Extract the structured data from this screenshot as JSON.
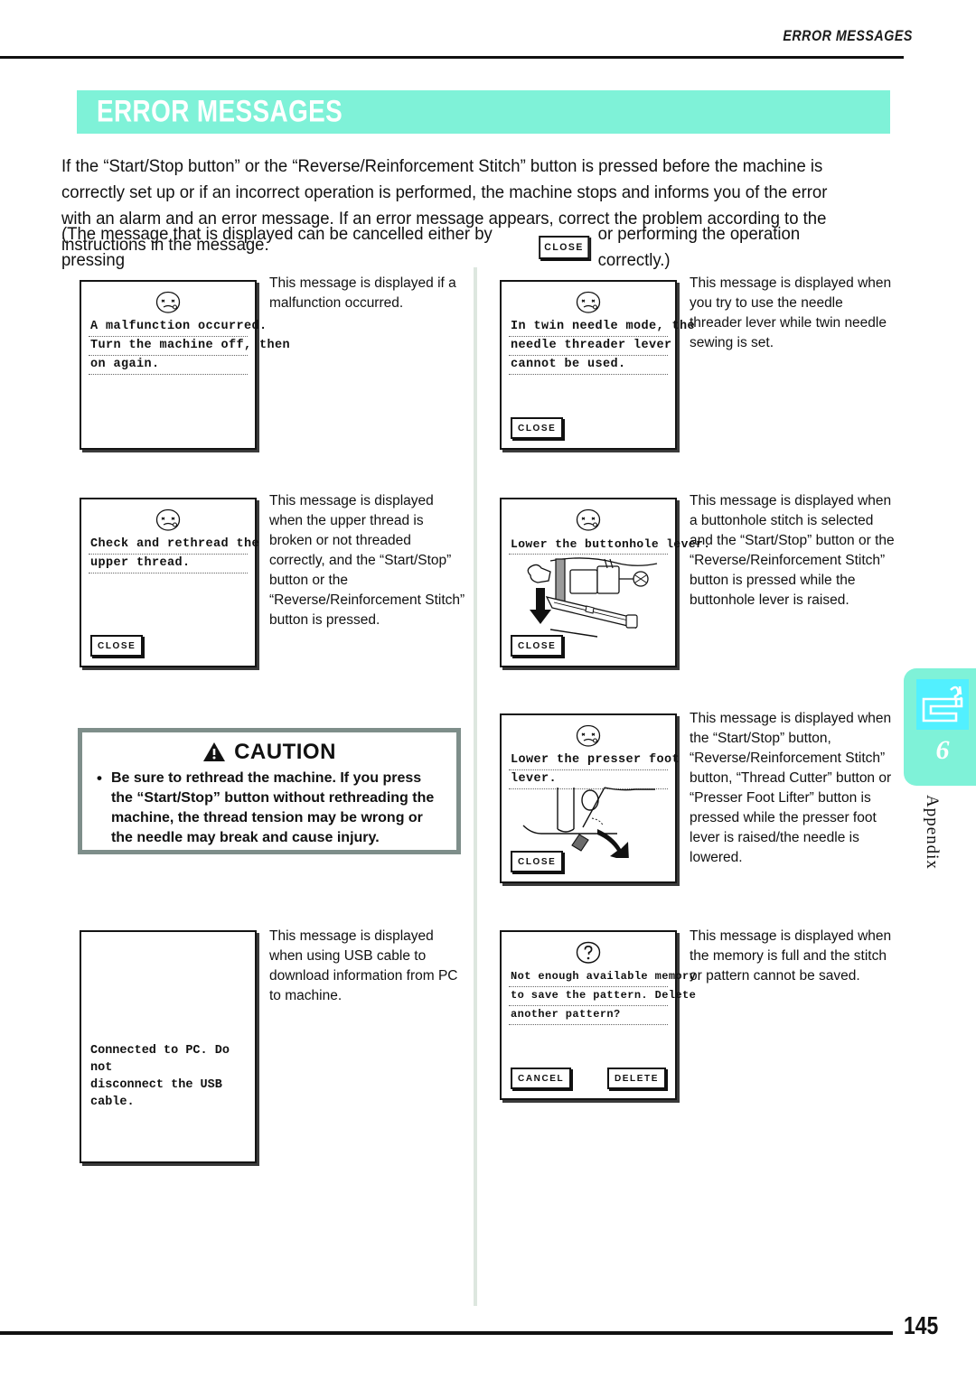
{
  "running_header": "ERROR MESSAGES",
  "banner": {
    "title": "ERROR MESSAGES",
    "color": "#7ff2d8"
  },
  "intro": {
    "paragraph": "If the “Start/Stop button” or the “Reverse/Reinforcement Stitch” button is pressed before the machine is correctly set up or if an incorrect operation is performed, the machine stops and informs you of the error with an alarm and an error message. If an error message appears, correct the problem according to the instructions in the message.",
    "cancel_prefix": "(The message that is displayed can be cancelled either by pressing",
    "cancel_button": "CLOSE",
    "cancel_suffix": "or performing the operation correctly.)"
  },
  "panels": [
    {
      "id": "malfunction",
      "face": "worried-face",
      "lines": [
        "A malfunction occurred.",
        "Turn the machine off, then",
        "on again."
      ],
      "buttons": [],
      "description": "This message is displayed if a malfunction occurred."
    },
    {
      "id": "twin-needle-threader",
      "face": "worried-face",
      "lines": [
        "In twin needle mode, the",
        "needle threader lever",
        "cannot be used."
      ],
      "buttons": [
        "CLOSE"
      ],
      "description": "This message is displayed when you try to use the needle threader lever while twin needle sewing is set."
    },
    {
      "id": "rethread-upper-thread",
      "face": "worried-face",
      "lines": [
        "Check and rethread the",
        "upper thread."
      ],
      "buttons": [
        "CLOSE"
      ],
      "description": "This message is displayed when the upper thread is broken or not threaded correctly, and the “Start/Stop” button or the “Reverse/Reinforcement Stitch” button is pressed."
    },
    {
      "id": "buttonhole-lever",
      "face": "worried-face",
      "lines": [
        "Lower the buttonhole lever."
      ],
      "illustration": "buttonhole-foot-with-down-arrow",
      "buttons": [
        "CLOSE"
      ],
      "description": "This message is displayed when a buttonhole stitch is selected and the “Start/Stop” button or the “Reverse/Reinforcement Stitch” button is pressed while the buttonhole lever is raised."
    },
    {
      "id": "presser-foot-lever",
      "face": "worried-face",
      "lines": [
        "Lower the presser foot",
        "lever."
      ],
      "illustration": "presser-foot-lever-with-curved-arrow",
      "buttons": [
        "CLOSE"
      ],
      "description": "This message is displayed when the “Start/Stop” button, “Reverse/Reinforcement Stitch” button, “Thread Cutter” button or “Presser Foot Lifter” button is pressed while the presser foot lever is raised/the needle is lowered."
    },
    {
      "id": "usb-connected",
      "face": "none",
      "free_text": [
        "Connected to PC. Do not",
        "disconnect the USB cable."
      ],
      "buttons": [],
      "description": "This message is displayed when using USB cable to download information from PC to machine."
    },
    {
      "id": "memory-full",
      "face": "question-face",
      "lines": [
        "Not enough available memory",
        "to save the pattern. Delete",
        "another pattern?"
      ],
      "buttons": [
        "CANCEL",
        "DELETE"
      ],
      "description": "This message is displayed when the memory is full and the stitch or pattern cannot be saved."
    }
  ],
  "caution": {
    "title": "CAUTION",
    "bullet": "•",
    "text": "Be sure to rethread the machine. If you press the “Start/Stop” button without rethreading the machine, the thread tension may be wrong or the needle may break and cause injury.",
    "border_color": "#7e8e8a"
  },
  "side_tab": {
    "number": "6",
    "label": "Appendix",
    "icon": "sewing-machine-question-icon",
    "tab_color": "#7ff2d8",
    "icon_color": "#52f0ff"
  },
  "footer": {
    "page_number": "145"
  }
}
